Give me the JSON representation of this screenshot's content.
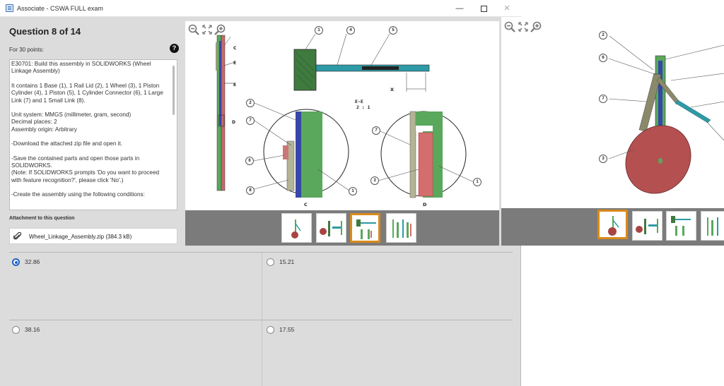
{
  "window": {
    "title": "Associate - CSWA FULL exam",
    "min": "—",
    "close": "✕"
  },
  "question": {
    "title": "Question 8 of 14",
    "points": "For 30 points:",
    "help": "?",
    "paragraphs": [
      "E30701: Build this assembly in SOLIDWORKS (Wheel Linkage Assembly)",
      "It contains 1 Base (1), 1 Rail Lid (2), 1 Wheel (3), 1 Piston Cylinder (4), 1 Piston (5), 1 Cylinder Connector (6), 1 Large Link (7) and 1 Small Link (8).",
      "Unit system: MMGS (millimeter, gram, second)\nDecimal places: 2\nAssembly origin: Arbitrary",
      "-Download the attached zip file and open it.",
      "-Save the contained parts and open those parts in SOLIDWORKS.\n(Note: If SOLIDWORKS prompts 'Do you want to proceed with feature recognition?', please click 'No'.)",
      "-Create the assembly using the following conditions:"
    ],
    "attachment_label": "Attachment to this question",
    "attachment_name": "Wheel_Linkage_Assembly.zip (384.3 kB)"
  },
  "drawing": {
    "balloons": [
      "1",
      "4",
      "5",
      "2",
      "7",
      "6",
      "8",
      "1",
      "7",
      "3",
      "1"
    ],
    "section_label": "E-E",
    "section_scale": "2 : 1",
    "dim_x": "X",
    "view_c": "C",
    "view_d": "D",
    "section_marks": [
      "E",
      "E"
    ],
    "detail_marks": [
      "C",
      "D"
    ]
  },
  "iso_balloons": [
    "2",
    "6",
    "7",
    "3"
  ],
  "answers": [
    {
      "label": "32.86",
      "selected": true
    },
    {
      "label": "15.21",
      "selected": false
    },
    {
      "label": "38.16",
      "selected": false
    },
    {
      "label": "17.55",
      "selected": false
    }
  ],
  "colors": {
    "accent": "#1e63c4",
    "thumb_selected": "#d98a1c",
    "base_green": "#5aa85c",
    "rail_blue": "#3647a8",
    "wheel_red": "#a84444",
    "piston_teal": "#2d9aa6"
  }
}
